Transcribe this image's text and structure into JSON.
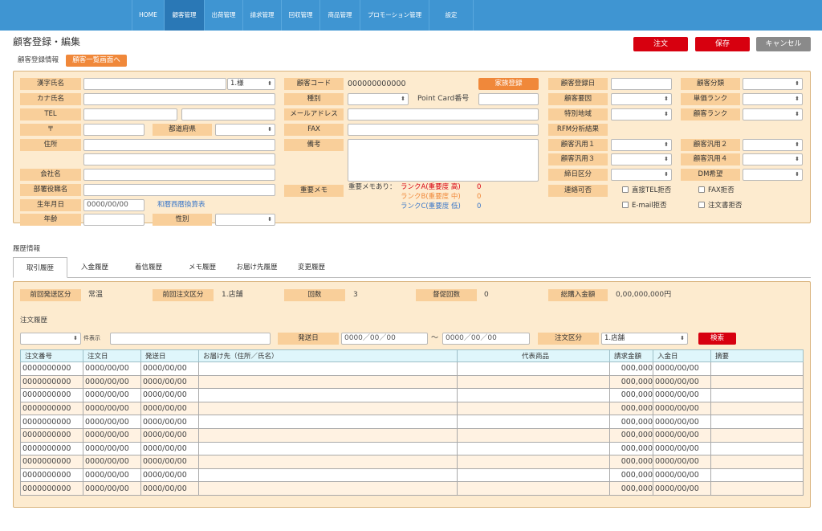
{
  "nav": {
    "items": [
      {
        "label": "HOME"
      },
      {
        "label": "顧客管理"
      },
      {
        "label": "出荷管理"
      },
      {
        "label": "請求管理"
      },
      {
        "label": "回収管理"
      },
      {
        "label": "商品管理"
      },
      {
        "label": "プロモーション管理"
      },
      {
        "label": "設定"
      }
    ]
  },
  "page": {
    "title": "顧客登録・編集"
  },
  "actions": {
    "order": "注文",
    "save": "保存",
    "cancel": "キャンセル"
  },
  "section1": {
    "title": "顧客登録情報",
    "back_button": "顧客一覧画面へ"
  },
  "form": {
    "kanji_name": "漢字氏名",
    "honorific": "1.様",
    "kana_name": "カナ氏名",
    "tel": "TEL",
    "postal": "〒",
    "prefecture": "都道府県",
    "address": "住所",
    "company": "会社名",
    "department": "部署役職名",
    "birthdate": "生年月日",
    "birthdate_value": "0000/00/00",
    "era_convert": "和暦西暦換算表",
    "age": "年齢",
    "gender": "性別",
    "customer_code": "顧客コード",
    "customer_code_value": "000000000000",
    "family_button": "家族登録",
    "type": "種別",
    "point_card": "Point Card番号",
    "email": "メールアドレス",
    "fax": "FAX",
    "notes": "備考",
    "important_memo": "重要メモ",
    "memo_present": "重要メモあり：",
    "rank_a": "ランクA(重要度 高)",
    "rank_a_val": "0",
    "rank_b": "ランクB(重要度 中)",
    "rank_b_val": "0",
    "rank_c": "ランクC(重要度 低)",
    "rank_c_val": "0",
    "reg_date": "顧客登録日",
    "factor": "顧客要因",
    "special_area": "特別地域",
    "rfm": "RFM分析結果",
    "general1": "顧客汎用１",
    "general3": "顧客汎用３",
    "closing": "締日区分",
    "contact_ok": "連絡可否",
    "category": "顧客分類",
    "price_rank": "単価ランク",
    "customer_rank": "顧客ランク",
    "general2": "顧客汎用２",
    "general4": "顧客汎用４",
    "dm": "DM希望",
    "chk_tel": "直接TEL拒否",
    "chk_fax": "FAX拒否",
    "chk_email": "E-mail拒否",
    "chk_order": "注文書拒否"
  },
  "history": {
    "title": "履歴情報",
    "tabs": [
      {
        "label": "取引履歴"
      },
      {
        "label": "入金履歴"
      },
      {
        "label": "着信履歴"
      },
      {
        "label": "メモ履歴"
      },
      {
        "label": "お届け先履歴"
      },
      {
        "label": "変更履歴"
      }
    ],
    "summary": {
      "prev_ship_label": "前回発送区分",
      "prev_ship_value": "常温",
      "prev_order_label": "前回注文区分",
      "prev_order_value": "1.店舗",
      "count_label": "回数",
      "count_value": "3",
      "promo_label": "督促回数",
      "promo_value": "0",
      "total_label": "総購入金額",
      "total_value": "0,00,000,000円"
    },
    "order_title": "注文履歴",
    "per_page": "件表示",
    "ship_date": "発送日",
    "date_from": "0000／00／00",
    "tilde": "～",
    "date_to": "0000／00／00",
    "order_kind": "注文区分",
    "order_kind_value": "1.店舗",
    "search": "検索",
    "columns": [
      "注文番号",
      "注文日",
      "発送日",
      "お届け先（住所／氏名）",
      "代表商品",
      "請求金額",
      "入金日",
      "摘要"
    ],
    "rows": [
      [
        "0000000000",
        "0000/00/00",
        "0000/00/00",
        "",
        "",
        "000,000",
        "0000/00/00",
        ""
      ],
      [
        "0000000000",
        "0000/00/00",
        "0000/00/00",
        "",
        "",
        "000,000",
        "0000/00/00",
        ""
      ],
      [
        "0000000000",
        "0000/00/00",
        "0000/00/00",
        "",
        "",
        "000,000",
        "0000/00/00",
        ""
      ],
      [
        "0000000000",
        "0000/00/00",
        "0000/00/00",
        "",
        "",
        "000,000",
        "0000/00/00",
        ""
      ],
      [
        "0000000000",
        "0000/00/00",
        "0000/00/00",
        "",
        "",
        "000,000",
        "0000/00/00",
        ""
      ],
      [
        "0000000000",
        "0000/00/00",
        "0000/00/00",
        "",
        "",
        "000,000",
        "0000/00/00",
        ""
      ],
      [
        "0000000000",
        "0000/00/00",
        "0000/00/00",
        "",
        "",
        "000,000",
        "0000/00/00",
        ""
      ],
      [
        "0000000000",
        "0000/00/00",
        "0000/00/00",
        "",
        "",
        "000,000",
        "0000/00/00",
        ""
      ],
      [
        "0000000000",
        "0000/00/00",
        "0000/00/00",
        "",
        "",
        "000,000",
        "0000/00/00",
        ""
      ],
      [
        "0000000000",
        "0000/00/00",
        "0000/00/00",
        "",
        "",
        "000,000",
        "0000/00/00",
        ""
      ]
    ]
  },
  "colors": {
    "nav": "#3f95d2",
    "label": "#f9cf9a",
    "panel": "#fdebcf",
    "accent_red": "#d7000f",
    "orange": "#f0883a"
  }
}
